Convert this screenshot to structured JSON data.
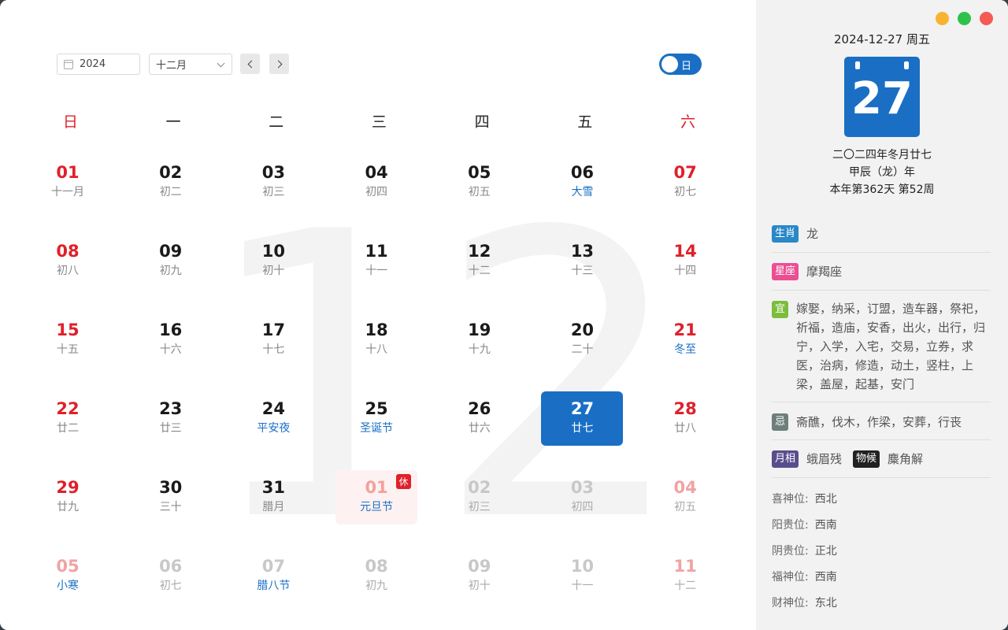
{
  "toolbar": {
    "year": "2024",
    "month": "十二月",
    "mode_label": "日"
  },
  "watermark_month": "12",
  "weekdays": [
    "日",
    "一",
    "二",
    "三",
    "四",
    "五",
    "六"
  ],
  "weeks": [
    [
      {
        "num": "01",
        "lunar": "十一月",
        "type": "cur"
      },
      {
        "num": "02",
        "lunar": "初二",
        "type": "cur"
      },
      {
        "num": "03",
        "lunar": "初三",
        "type": "cur"
      },
      {
        "num": "04",
        "lunar": "初四",
        "type": "cur"
      },
      {
        "num": "05",
        "lunar": "初五",
        "type": "cur"
      },
      {
        "num": "06",
        "lunar": "大雪",
        "type": "cur",
        "fest": true
      },
      {
        "num": "07",
        "lunar": "初七",
        "type": "cur"
      }
    ],
    [
      {
        "num": "08",
        "lunar": "初八",
        "type": "cur"
      },
      {
        "num": "09",
        "lunar": "初九",
        "type": "cur"
      },
      {
        "num": "10",
        "lunar": "初十",
        "type": "cur"
      },
      {
        "num": "11",
        "lunar": "十一",
        "type": "cur"
      },
      {
        "num": "12",
        "lunar": "十二",
        "type": "cur"
      },
      {
        "num": "13",
        "lunar": "十三",
        "type": "cur"
      },
      {
        "num": "14",
        "lunar": "十四",
        "type": "cur"
      }
    ],
    [
      {
        "num": "15",
        "lunar": "十五",
        "type": "cur"
      },
      {
        "num": "16",
        "lunar": "十六",
        "type": "cur"
      },
      {
        "num": "17",
        "lunar": "十七",
        "type": "cur"
      },
      {
        "num": "18",
        "lunar": "十八",
        "type": "cur"
      },
      {
        "num": "19",
        "lunar": "十九",
        "type": "cur"
      },
      {
        "num": "20",
        "lunar": "二十",
        "type": "cur"
      },
      {
        "num": "21",
        "lunar": "冬至",
        "type": "cur",
        "fest": true
      }
    ],
    [
      {
        "num": "22",
        "lunar": "廿二",
        "type": "cur"
      },
      {
        "num": "23",
        "lunar": "廿三",
        "type": "cur"
      },
      {
        "num": "24",
        "lunar": "平安夜",
        "type": "cur",
        "fest": true
      },
      {
        "num": "25",
        "lunar": "圣诞节",
        "type": "cur",
        "fest": true
      },
      {
        "num": "26",
        "lunar": "廿六",
        "type": "cur"
      },
      {
        "num": "27",
        "lunar": "廿七",
        "type": "cur",
        "selected": true
      },
      {
        "num": "28",
        "lunar": "廿八",
        "type": "cur"
      }
    ],
    [
      {
        "num": "29",
        "lunar": "廿九",
        "type": "cur"
      },
      {
        "num": "30",
        "lunar": "三十",
        "type": "cur"
      },
      {
        "num": "31",
        "lunar": "腊月",
        "type": "cur"
      },
      {
        "num": "01",
        "lunar": "元旦节",
        "type": "other",
        "fest": true,
        "holiday": true,
        "badge": "休"
      },
      {
        "num": "02",
        "lunar": "初三",
        "type": "other"
      },
      {
        "num": "03",
        "lunar": "初四",
        "type": "other"
      },
      {
        "num": "04",
        "lunar": "初五",
        "type": "other"
      }
    ],
    [
      {
        "num": "05",
        "lunar": "小寒",
        "type": "other",
        "fest": true
      },
      {
        "num": "06",
        "lunar": "初七",
        "type": "other"
      },
      {
        "num": "07",
        "lunar": "腊八节",
        "type": "other",
        "fest": true
      },
      {
        "num": "08",
        "lunar": "初九",
        "type": "other"
      },
      {
        "num": "09",
        "lunar": "初十",
        "type": "other"
      },
      {
        "num": "10",
        "lunar": "十一",
        "type": "other"
      },
      {
        "num": "11",
        "lunar": "十二",
        "type": "other"
      }
    ]
  ],
  "side": {
    "date_line": "2024-12-27 周五",
    "big_day": "27",
    "lunar_date": "二〇二四年冬月廿七",
    "ganzhi_year": "甲辰（龙）年",
    "year_progress": "本年第362天 第52周",
    "zodiac_label": "生肖",
    "zodiac": "龙",
    "constellation_label": "星座",
    "constellation": "摩羯座",
    "yi_label": "宜",
    "yi": "嫁娶，纳采，订盟，造车器，祭祀，祈福，造庙，安香，出火，出行，归宁，入学，入宅，交易，立券，求医，治病，修造，动土，竖柱，上梁，盖屋，起基，安门",
    "ji_label": "忌",
    "ji": "斋醮，伐木，作梁，安葬，行丧",
    "moon_label": "月相",
    "moon": "蛾眉残",
    "phenology_label": "物候",
    "phenology": "麋角解",
    "positions": [
      {
        "label": "喜神位:",
        "value": "西北"
      },
      {
        "label": "阳贵位:",
        "value": "西南"
      },
      {
        "label": "阴贵位:",
        "value": "正北"
      },
      {
        "label": "福神位:",
        "value": "西南"
      },
      {
        "label": "财神位:",
        "value": "东北"
      }
    ]
  },
  "colors": {
    "accent": "#1a6fc4",
    "weekend": "#e0202a",
    "festival": "#1a6fc4"
  }
}
